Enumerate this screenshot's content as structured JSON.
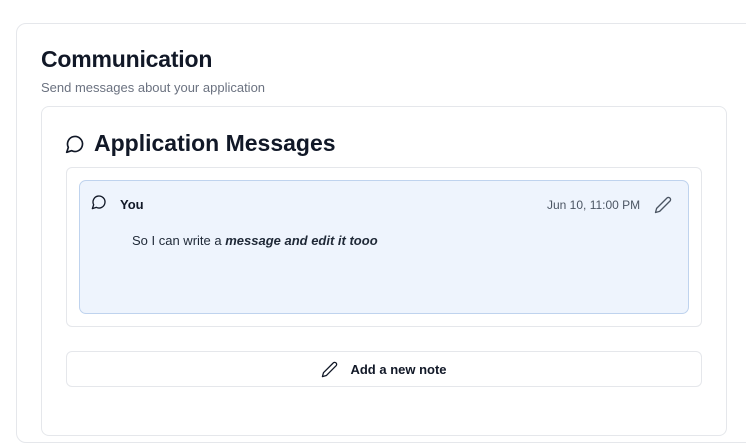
{
  "section": {
    "title": "Communication",
    "subtitle": "Send messages about your application"
  },
  "messages_panel": {
    "title": "Application Messages",
    "title_icon": "message-circle-icon"
  },
  "messages": [
    {
      "author": "You",
      "timestamp": "Jun 10, 11:00 PM",
      "body_plain": "So I can write a ",
      "body_emphasis": "message and edit it tooo",
      "icon": "message-circle-icon",
      "edit_icon": "pencil-icon"
    }
  ],
  "actions": {
    "add_note_label": "Add a new note",
    "add_note_icon": "pencil-icon"
  },
  "colors": {
    "message_bg": "#eef4fd",
    "message_border": "#bfd3ee",
    "border": "#e5e7eb",
    "subtitle": "#6b7280"
  }
}
